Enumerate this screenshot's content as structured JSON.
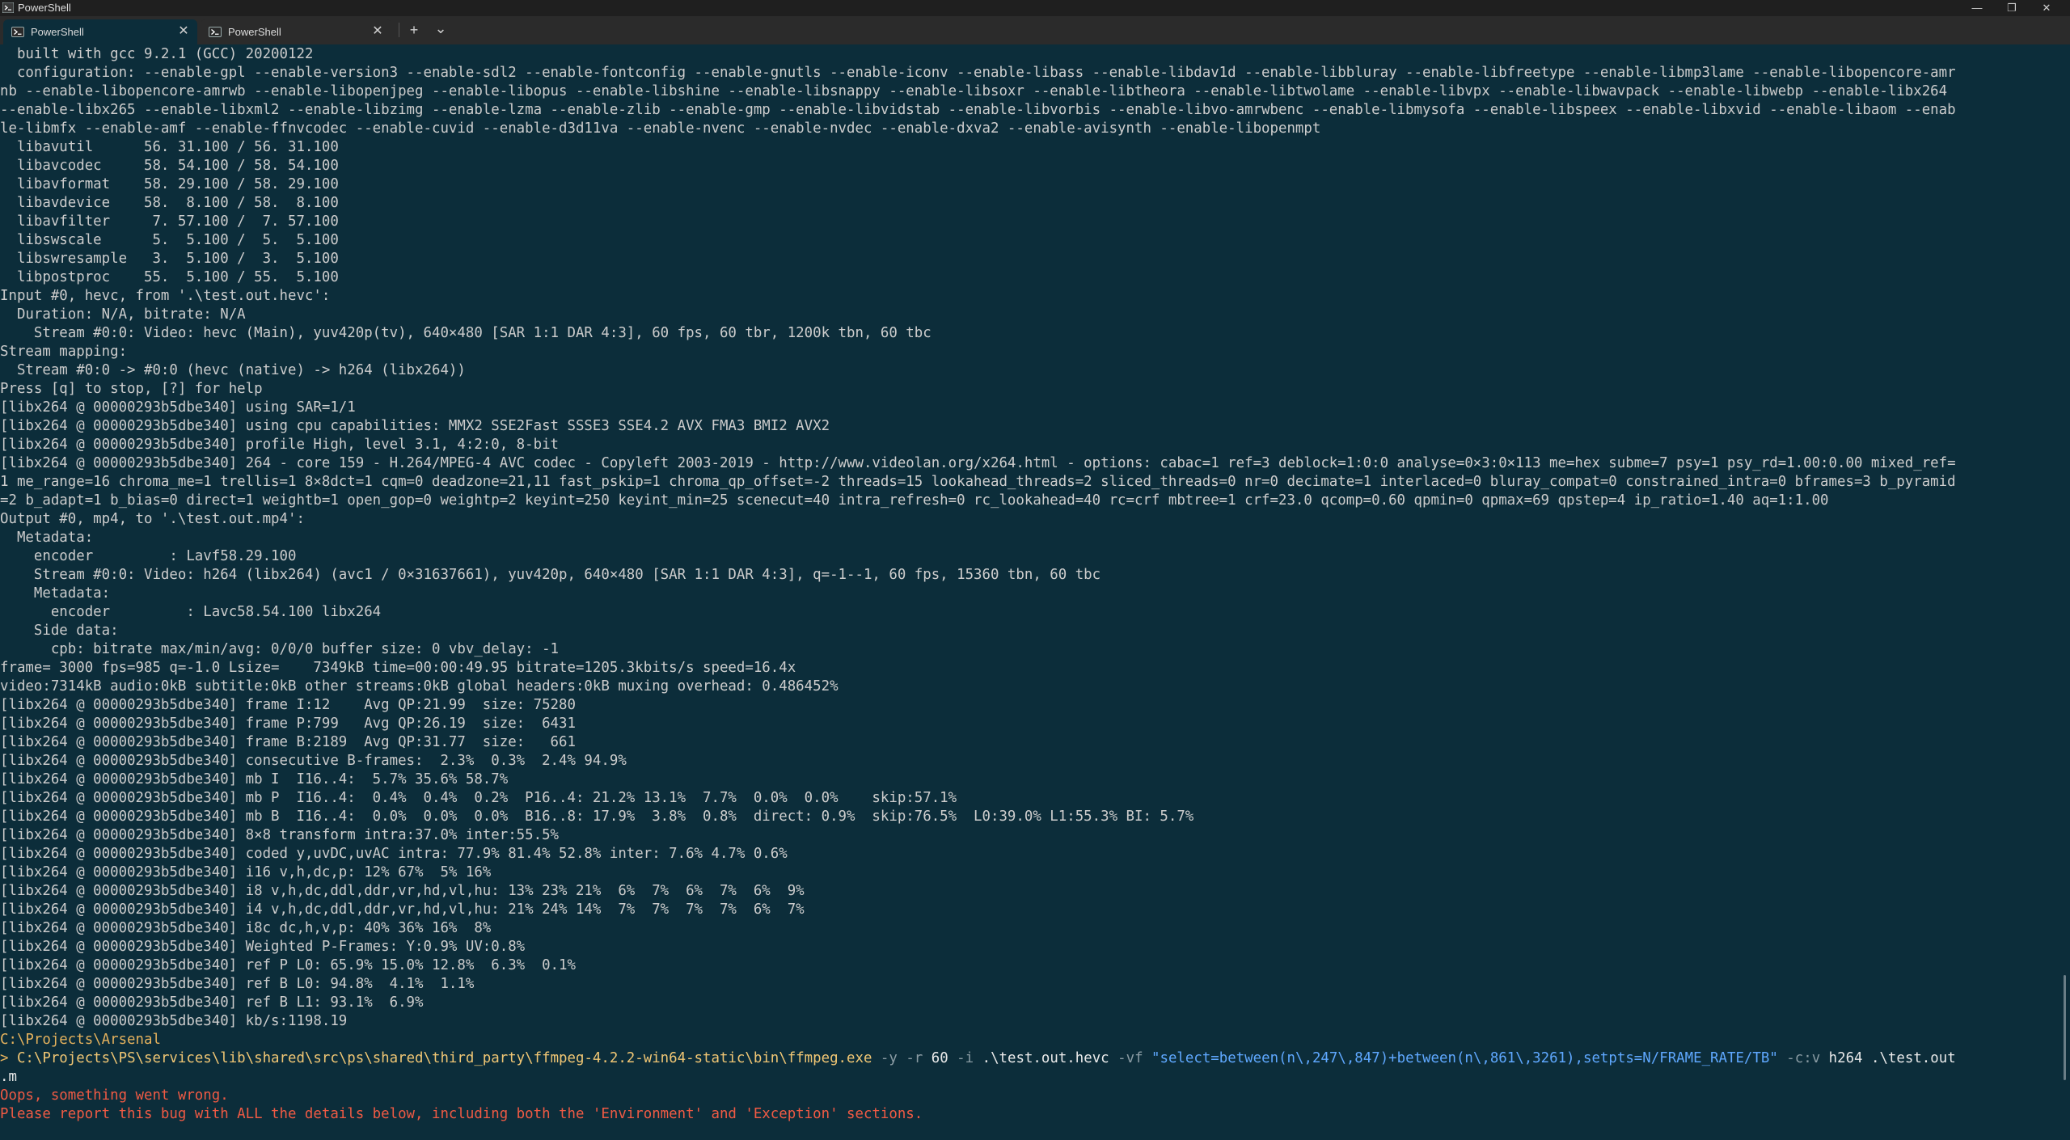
{
  "window": {
    "title": "PowerShell",
    "minimize_glyph": "—",
    "restore_glyph": "❐",
    "close_glyph": "✕"
  },
  "tabs": [
    {
      "label": "PowerShell",
      "active": true,
      "icon": "powershell-icon",
      "close_glyph": "✕"
    },
    {
      "label": "PowerShell",
      "active": false,
      "icon": "powershell-icon",
      "close_glyph": "✕"
    }
  ],
  "tabstrip": {
    "new_tab_glyph": "+",
    "dropdown_glyph": "⌄"
  },
  "colors": {
    "terminal_bg": "#0c2d3a",
    "prompt": "#e5b25d",
    "error": "#f05a44",
    "string": "#5fa8ff"
  },
  "output_lines": [
    "  built with gcc 9.2.1 (GCC) 20200122",
    "  configuration: --enable-gpl --enable-version3 --enable-sdl2 --enable-fontconfig --enable-gnutls --enable-iconv --enable-libass --enable-libdav1d --enable-libbluray --enable-libfreetype --enable-libmp3lame --enable-libopencore-amr",
    "nb --enable-libopencore-amrwb --enable-libopenjpeg --enable-libopus --enable-libshine --enable-libsnappy --enable-libsoxr --enable-libtheora --enable-libtwolame --enable-libvpx --enable-libwavpack --enable-libwebp --enable-libx264",
    "--enable-libx265 --enable-libxml2 --enable-libzimg --enable-lzma --enable-zlib --enable-gmp --enable-libvidstab --enable-libvorbis --enable-libvo-amrwbenc --enable-libmysofa --enable-libspeex --enable-libxvid --enable-libaom --enab",
    "le-libmfx --enable-amf --enable-ffnvcodec --enable-cuvid --enable-d3d11va --enable-nvenc --enable-nvdec --enable-dxva2 --enable-avisynth --enable-libopenmpt",
    "  libavutil      56. 31.100 / 56. 31.100",
    "  libavcodec     58. 54.100 / 58. 54.100",
    "  libavformat    58. 29.100 / 58. 29.100",
    "  libavdevice    58.  8.100 / 58.  8.100",
    "  libavfilter     7. 57.100 /  7. 57.100",
    "  libswscale      5.  5.100 /  5.  5.100",
    "  libswresample   3.  5.100 /  3.  5.100",
    "  libpostproc    55.  5.100 / 55.  5.100",
    "Input #0, hevc, from '.\\test.out.hevc':",
    "  Duration: N/A, bitrate: N/A",
    "    Stream #0:0: Video: hevc (Main), yuv420p(tv), 640×480 [SAR 1:1 DAR 4:3], 60 fps, 60 tbr, 1200k tbn, 60 tbc",
    "Stream mapping:",
    "  Stream #0:0 -> #0:0 (hevc (native) -> h264 (libx264))",
    "Press [q] to stop, [?] for help",
    "[libx264 @ 00000293b5dbe340] using SAR=1/1",
    "[libx264 @ 00000293b5dbe340] using cpu capabilities: MMX2 SSE2Fast SSSE3 SSE4.2 AVX FMA3 BMI2 AVX2",
    "[libx264 @ 00000293b5dbe340] profile High, level 3.1, 4:2:0, 8-bit",
    "[libx264 @ 00000293b5dbe340] 264 - core 159 - H.264/MPEG-4 AVC codec - Copyleft 2003-2019 - http://www.videolan.org/x264.html - options: cabac=1 ref=3 deblock=1:0:0 analyse=0×3:0×113 me=hex subme=7 psy=1 psy_rd=1.00:0.00 mixed_ref=",
    "1 me_range=16 chroma_me=1 trellis=1 8×8dct=1 cqm=0 deadzone=21,11 fast_pskip=1 chroma_qp_offset=-2 threads=15 lookahead_threads=2 sliced_threads=0 nr=0 decimate=1 interlaced=0 bluray_compat=0 constrained_intra=0 bframes=3 b_pyramid",
    "=2 b_adapt=1 b_bias=0 direct=1 weightb=1 open_gop=0 weightp=2 keyint=250 keyint_min=25 scenecut=40 intra_refresh=0 rc_lookahead=40 rc=crf mbtree=1 crf=23.0 qcomp=0.60 qpmin=0 qpmax=69 qpstep=4 ip_ratio=1.40 aq=1:1.00",
    "Output #0, mp4, to '.\\test.out.mp4':",
    "  Metadata:",
    "    encoder         : Lavf58.29.100",
    "    Stream #0:0: Video: h264 (libx264) (avc1 / 0×31637661), yuv420p, 640×480 [SAR 1:1 DAR 4:3], q=-1--1, 60 fps, 15360 tbn, 60 tbc",
    "    Metadata:",
    "      encoder         : Lavc58.54.100 libx264",
    "    Side data:",
    "      cpb: bitrate max/min/avg: 0/0/0 buffer size: 0 vbv_delay: -1",
    "frame= 3000 fps=985 q=-1.0 Lsize=    7349kB time=00:00:49.95 bitrate=1205.3kbits/s speed=16.4x",
    "video:7314kB audio:0kB subtitle:0kB other streams:0kB global headers:0kB muxing overhead: 0.486452%",
    "[libx264 @ 00000293b5dbe340] frame I:12    Avg QP:21.99  size: 75280",
    "[libx264 @ 00000293b5dbe340] frame P:799   Avg QP:26.19  size:  6431",
    "[libx264 @ 00000293b5dbe340] frame B:2189  Avg QP:31.77  size:   661",
    "[libx264 @ 00000293b5dbe340] consecutive B-frames:  2.3%  0.3%  2.4% 94.9%",
    "[libx264 @ 00000293b5dbe340] mb I  I16..4:  5.7% 35.6% 58.7%",
    "[libx264 @ 00000293b5dbe340] mb P  I16..4:  0.4%  0.4%  0.2%  P16..4: 21.2% 13.1%  7.7%  0.0%  0.0%    skip:57.1%",
    "[libx264 @ 00000293b5dbe340] mb B  I16..4:  0.0%  0.0%  0.0%  B16..8: 17.9%  3.8%  0.8%  direct: 0.9%  skip:76.5%  L0:39.0% L1:55.3% BI: 5.7%",
    "[libx264 @ 00000293b5dbe340] 8×8 transform intra:37.0% inter:55.5%",
    "[libx264 @ 00000293b5dbe340] coded y,uvDC,uvAC intra: 77.9% 81.4% 52.8% inter: 7.6% 4.7% 0.6%",
    "[libx264 @ 00000293b5dbe340] i16 v,h,dc,p: 12% 67%  5% 16%",
    "[libx264 @ 00000293b5dbe340] i8 v,h,dc,ddl,ddr,vr,hd,vl,hu: 13% 23% 21%  6%  7%  6%  7%  6%  9%",
    "[libx264 @ 00000293b5dbe340] i4 v,h,dc,ddl,ddr,vr,hd,vl,hu: 21% 24% 14%  7%  7%  7%  7%  6%  7%",
    "[libx264 @ 00000293b5dbe340] i8c dc,h,v,p: 40% 36% 16%  8%",
    "[libx264 @ 00000293b5dbe340] Weighted P-Frames: Y:0.9% UV:0.8%",
    "[libx264 @ 00000293b5dbe340] ref P L0: 65.9% 15.0% 12.8%  6.3%  0.1%",
    "[libx264 @ 00000293b5dbe340] ref B L0: 94.8%  4.1%  1.1%",
    "[libx264 @ 00000293b5dbe340] ref B L1: 93.1%  6.9%",
    "[libx264 @ 00000293b5dbe340] kb/s:1198.19"
  ],
  "prompt": {
    "directory": "C:\\Projects\\Arsenal",
    "arrow": "> ",
    "exe": "C:\\Projects\\PS\\services\\lib\\shared\\src\\ps\\shared\\third_party\\ffmpeg-4.2.2-win64-static\\bin\\ffmpeg.exe",
    "p1": " -y",
    "p2": " -r",
    "n1": " 60",
    "p3": " -i",
    "a1": " .\\test.out.hevc",
    "p4": " -vf",
    "s1": " \"select=between(n\\,247\\,847)+between(n\\,861\\,3261),setpts=N/FRAME_RATE/TB\"",
    "p5": " -c:v",
    "a2": " h264 .\\test.out",
    "wrap": ".m"
  },
  "errors": [
    "Oops, something went wrong.",
    "Please report this bug with ALL the details below, including both the 'Environment' and 'Exception' sections."
  ]
}
